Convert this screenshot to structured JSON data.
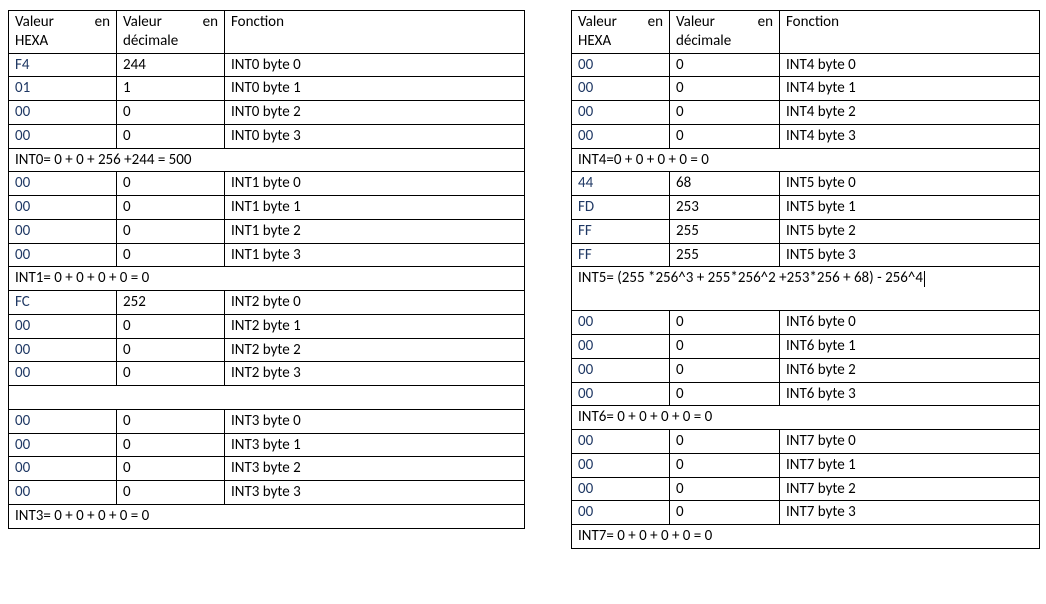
{
  "headers": {
    "hexa_line1": "Valeur",
    "hexa_en": "en",
    "hexa_line2": "HEXA",
    "dec_line1": "Valeur",
    "dec_en": "en",
    "dec_line2": "décimale",
    "fonction": "Fonction"
  },
  "left": {
    "rows": [
      {
        "hex": "F4",
        "dec": "244",
        "fn": "INT0 byte 0"
      },
      {
        "hex": "01",
        "dec": "1",
        "fn": "INT0 byte 1"
      },
      {
        "hex": "00",
        "dec": "0",
        "fn": "INT0 byte 2"
      },
      {
        "hex": "00",
        "dec": "0",
        "fn": "INT0 byte 3"
      },
      {
        "summary": "INT0= 0 + 0 + 256 +244 = 500"
      },
      {
        "hex": "00",
        "dec": "0",
        "fn": "INT1 byte 0"
      },
      {
        "hex": "00",
        "dec": "0",
        "fn": "INT1 byte 1"
      },
      {
        "hex": "00",
        "dec": "0",
        "fn": "INT1 byte 2"
      },
      {
        "hex": "00",
        "dec": "0",
        "fn": "INT1 byte 3"
      },
      {
        "summary": "INT1= 0 + 0 + 0 + 0 = 0"
      },
      {
        "hex": "FC",
        "dec": "252",
        "fn": "INT2 byte 0"
      },
      {
        "hex": "00",
        "dec": "0",
        "fn": "INT2 byte 1"
      },
      {
        "hex": "00",
        "dec": "0",
        "fn": "INT2 byte 2"
      },
      {
        "hex": "00",
        "dec": "0",
        "fn": "INT2 byte 3"
      },
      {
        "blank": true
      },
      {
        "hex": "00",
        "dec": "0",
        "fn": "INT3 byte 0"
      },
      {
        "hex": "00",
        "dec": "0",
        "fn": "INT3 byte 1"
      },
      {
        "hex": "00",
        "dec": "0",
        "fn": "INT3 byte 2"
      },
      {
        "hex": "00",
        "dec": "0",
        "fn": "INT3 byte 3"
      },
      {
        "summary": "INT3= 0 + 0 + 0 + 0 = 0"
      }
    ]
  },
  "right": {
    "rows": [
      {
        "hex": "00",
        "dec": "0",
        "fn": "INT4 byte 0"
      },
      {
        "hex": "00",
        "dec": "0",
        "fn": "INT4 byte 1"
      },
      {
        "hex": "00",
        "dec": "0",
        "fn": "INT4 byte 2"
      },
      {
        "hex": "00",
        "dec": "0",
        "fn": "INT4 byte 3"
      },
      {
        "summary": "INT4=0 + 0 + 0 + 0 = 0"
      },
      {
        "hex": "44",
        "dec": "68",
        "fn": "INT5 byte 0"
      },
      {
        "hex": "FD",
        "dec": "253",
        "fn": "INT5 byte 1"
      },
      {
        "hex": "FF",
        "dec": "255",
        "fn": "INT5 byte 2"
      },
      {
        "hex": "FF",
        "dec": "255",
        "fn": "INT5 byte 3"
      },
      {
        "summary_tall": "INT5= (255 *256^3 + 255*256^2 +253*256 + 68) - 256^4",
        "caret": true
      },
      {
        "hex": "00",
        "dec": "0",
        "fn": "INT6 byte 0"
      },
      {
        "hex": "00",
        "dec": "0",
        "fn": "INT6 byte 1"
      },
      {
        "hex": "00",
        "dec": "0",
        "fn": "INT6 byte 2"
      },
      {
        "hex": "00",
        "dec": "0",
        "fn": "INT6 byte 3"
      },
      {
        "summary": "INT6= 0 + 0 + 0 + 0 = 0"
      },
      {
        "hex": "00",
        "dec": "0",
        "fn": "INT7 byte 0"
      },
      {
        "hex": "00",
        "dec": "0",
        "fn": "INT7 byte 1"
      },
      {
        "hex": "00",
        "dec": "0",
        "fn": "INT7 byte 2"
      },
      {
        "hex": "00",
        "dec": "0",
        "fn": "INT7 byte 3"
      },
      {
        "summary": "INT7= 0 + 0 + 0 + 0 = 0"
      }
    ]
  }
}
